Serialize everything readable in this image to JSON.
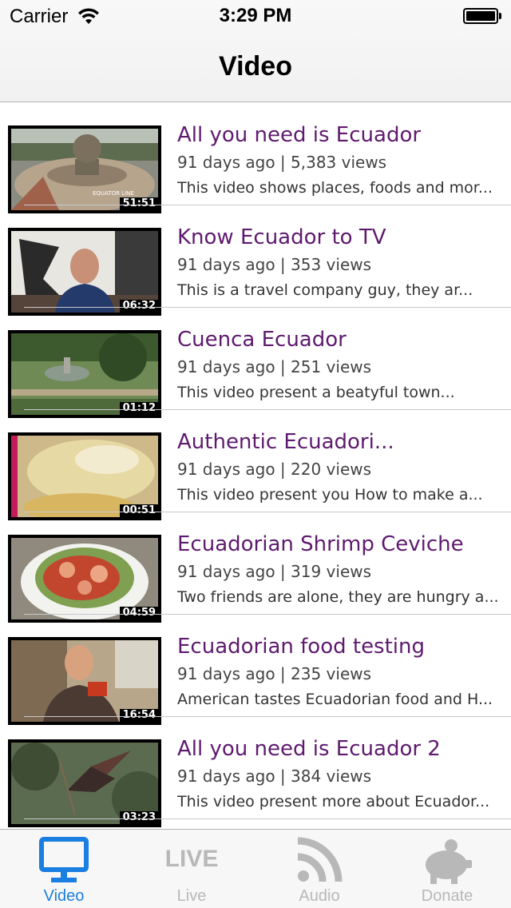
{
  "status_bar": {
    "carrier": "Carrier",
    "time": "3:29 PM"
  },
  "nav": {
    "title": "Video"
  },
  "videos": [
    {
      "title": "All you need is Ecuador",
      "age": "91 days ago",
      "views": "5,383 views",
      "description": "This video shows places, foods and mor...",
      "duration": "51:51",
      "thumb": "equator-line"
    },
    {
      "title": "Know Ecuador to TV",
      "age": "91 days ago",
      "views": "353 views",
      "description": "This is a travel company guy, they ar...",
      "duration": "06:32",
      "thumb": "man-speaking"
    },
    {
      "title": "Cuenca Ecuador",
      "age": "91 days ago",
      "views": "251 views",
      "description": "This video present a beatyful town...",
      "duration": "01:12",
      "thumb": "park-fountain"
    },
    {
      "title": "Authentic Ecuadori...",
      "age": "91 days ago",
      "views": "220 views",
      "description": "This video present you How to make a...",
      "duration": "00:51",
      "thumb": "empanada"
    },
    {
      "title": "Ecuadorian Shrimp Ceviche",
      "age": "91 days ago",
      "views": "319 views",
      "description": "Two friends are alone, they are hungry a...",
      "duration": "04:59",
      "thumb": "ceviche"
    },
    {
      "title": "Ecuadorian food testing",
      "age": "91 days ago",
      "views": "235 views",
      "description": "American tastes Ecuadorian food and H...",
      "duration": "16:54",
      "thumb": "man-kitchen"
    },
    {
      "title": "All you need is Ecuador 2",
      "age": "91 days ago",
      "views": "384 views",
      "description": "This video present more about Ecuador...",
      "duration": "03:23",
      "thumb": "hummingbird"
    }
  ],
  "tabs": [
    {
      "label": "Video",
      "icon": "monitor-icon",
      "active": true
    },
    {
      "label": "Live",
      "icon": "live-icon",
      "active": false
    },
    {
      "label": "Audio",
      "icon": "rss-icon",
      "active": false
    },
    {
      "label": "Donate",
      "icon": "piggy-bank-icon",
      "active": false
    }
  ],
  "colors": {
    "title": "#5e1a6e",
    "tab_active": "#1a7fe0",
    "tab_inactive": "#b8b8b8"
  }
}
